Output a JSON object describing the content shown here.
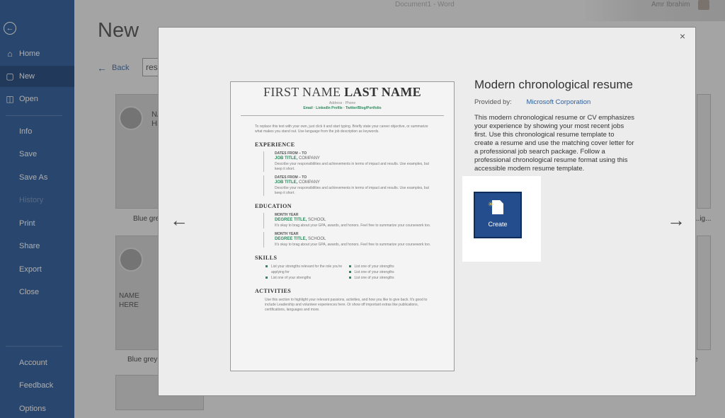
{
  "window": {
    "title": "Document1 - Word",
    "user": "Amr Ibrahim"
  },
  "sidebar": {
    "items": [
      {
        "label": "Home",
        "icon": "home-icon"
      },
      {
        "label": "New",
        "icon": "new-document-icon"
      },
      {
        "label": "Open",
        "icon": "folder-open-icon"
      },
      {
        "label": "Info"
      },
      {
        "label": "Save"
      },
      {
        "label": "Save As"
      },
      {
        "label": "History"
      },
      {
        "label": "Print"
      },
      {
        "label": "Share"
      },
      {
        "label": "Export"
      },
      {
        "label": "Close"
      },
      {
        "label": "Account"
      },
      {
        "label": "Feedback"
      },
      {
        "label": "Options"
      }
    ]
  },
  "main": {
    "title": "New",
    "back_label": "Back",
    "search_value": "resume",
    "thumbs": [
      {
        "label": "Blue grey",
        "name": "NA\nHE"
      },
      {
        "label": "Blue grey",
        "name": "NAME\nHERE"
      }
    ],
    "right_label": "...ig...",
    "right_label_2": "e"
  },
  "modal": {
    "close": "×",
    "template_title": "Modern chronological resume",
    "provided_by_label": "Provided by:",
    "provided_by": "Microsoft Corporation",
    "description": "This modern chronological resume or CV emphasizes your experience by showing your most recent jobs first. Use this chronological resume template to create a resume and use the matching cover letter for a professional job search package. Follow a professional chronological resume format using this accessible modern resume template.",
    "create_label": "Create",
    "preview": {
      "first_name": "FIRST NAME",
      "last_name": "LAST NAME",
      "contact": "Address · Phone",
      "links": "Email · LinkedIn Profile · Twitter/Blog/Portfolio",
      "intro": "To replace this text with your own, just click it and start typing. Briefly state your career objective, or summarize what makes you stand out. Use language from the job description as keywords.",
      "experience_heading": "EXPERIENCE",
      "experience": [
        {
          "dates": "DATES FROM – TO",
          "title": "JOB TITLE",
          "company": "COMPANY",
          "desc": "Describe your responsibilities and achievements in terms of impact and results. Use examples, but keep it short."
        },
        {
          "dates": "DATES FROM – TO",
          "title": "JOB TITLE",
          "company": "COMPANY",
          "desc": "Describe your responsibilities and achievements in terms of impact and results. Use examples, but keep it short."
        }
      ],
      "education_heading": "EDUCATION",
      "education": [
        {
          "dates": "MONTH YEAR",
          "title": "DEGREE TITLE",
          "company": "SCHOOL",
          "desc": "It's okay to brag about your GPA, awards, and honors. Feel free to summarize your coursework too."
        },
        {
          "dates": "MONTH YEAR",
          "title": "DEGREE TITLE",
          "company": "SCHOOL",
          "desc": "It's okay to brag about your GPA, awards, and honors. Feel free to summarize your coursework too."
        }
      ],
      "skills_heading": "SKILLS",
      "skills_left": [
        "List your strengths relevant for the role you're applying for",
        "List one of your strengths"
      ],
      "skills_right": [
        "List one of your strengths",
        "List one of your strengths",
        "List one of your strengths"
      ],
      "activities_heading": "ACTIVITIES",
      "activities": "Use this section to highlight your relevant passions, activities, and how you like to give back. It's good to include Leadership and volunteer experiences here. Or show off important extras like publications, certifications, languages and more."
    }
  }
}
